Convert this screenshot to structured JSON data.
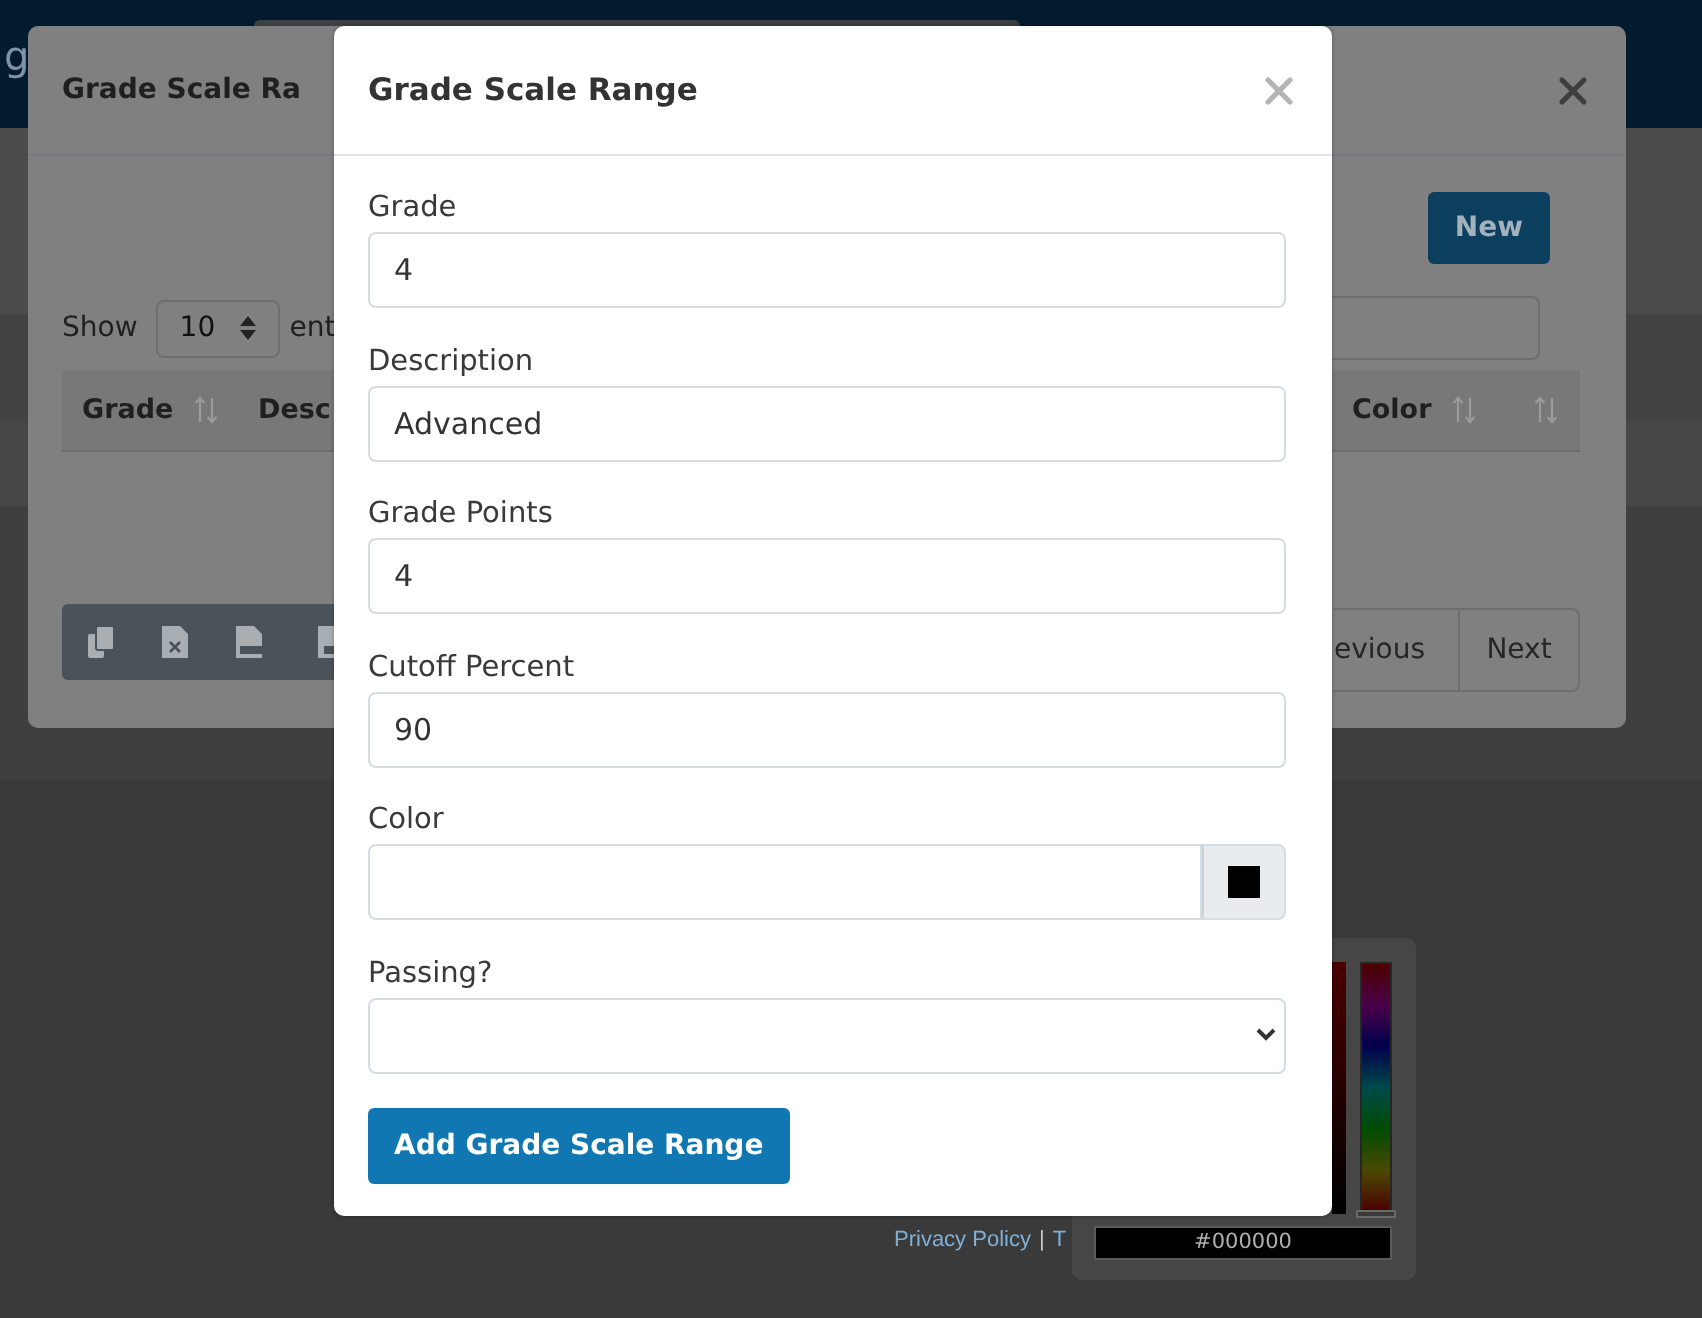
{
  "navbar": {
    "brand": "g"
  },
  "background_modal": {
    "title": "Grade Scale Ra",
    "new_button": "New",
    "length_menu": {
      "label": "Show",
      "value": "10",
      "suffix": "ent"
    },
    "table": {
      "columns": [
        {
          "kind": "text",
          "label": "Grade"
        },
        {
          "kind": "text",
          "label": "Desc"
        },
        {
          "kind": "text",
          "label": "Color"
        },
        {
          "kind": "sort-only"
        }
      ]
    },
    "pagination": [
      {
        "label": "evious"
      },
      {
        "label": "Next"
      }
    ]
  },
  "foreground_modal": {
    "title": "Grade Scale Range",
    "fields": [
      {
        "kind": "text",
        "label": "Grade",
        "value": "4"
      },
      {
        "kind": "text",
        "label": "Description",
        "value": "Advanced"
      },
      {
        "kind": "text",
        "label": "Grade Points",
        "value": "4"
      },
      {
        "kind": "text",
        "label": "Cutoff Percent",
        "value": "90"
      },
      {
        "kind": "color",
        "label": "Color"
      },
      {
        "kind": "select",
        "label": "Passing?"
      }
    ],
    "submit_button": "Add Grade Scale Range"
  },
  "color_picker": {
    "hue_slider": {
      "level": 0
    },
    "hex": "#000000"
  },
  "footer": {
    "items": [
      {
        "kind": "link",
        "text": "Privacy Policy"
      },
      {
        "kind": "separator",
        "text": "|"
      },
      {
        "kind": "link",
        "text": "T"
      }
    ]
  }
}
